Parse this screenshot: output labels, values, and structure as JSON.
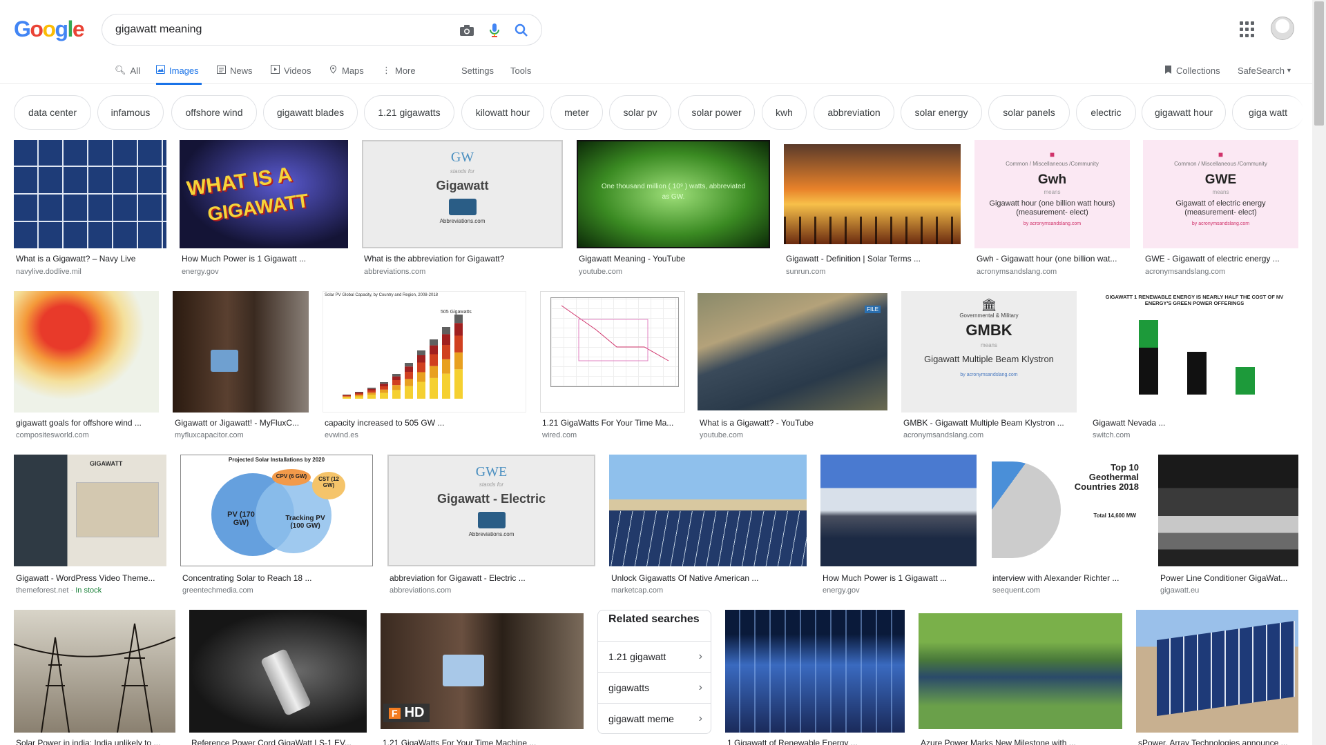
{
  "header": {
    "logo_text": "Google",
    "search_query": "gigawatt meaning"
  },
  "tabs": {
    "all": "All",
    "images": "Images",
    "news": "News",
    "videos": "Videos",
    "maps": "Maps",
    "more": "More",
    "settings": "Settings",
    "tools": "Tools",
    "collections": "Collections",
    "safesearch": "SafeSearch"
  },
  "chips": [
    "data center",
    "infamous",
    "offshore wind",
    "gigawatt blades",
    "1.21 gigawatts",
    "kilowatt hour",
    "meter",
    "solar pv",
    "solar power",
    "kwh",
    "abbreviation",
    "solar energy",
    "solar panels",
    "electric",
    "gigawatt hour",
    "giga watt"
  ],
  "results": [
    {
      "caption": "What is a Gigawatt? – Navy Live",
      "source": "navylive.dodlive.mil"
    },
    {
      "caption": "How Much Power is 1 Gigawatt ...",
      "source": "energy.gov"
    },
    {
      "caption": "What is the abbreviation for Gigawatt?",
      "source": "abbreviations.com"
    },
    {
      "caption": "Gigawatt Meaning - YouTube",
      "source": "youtube.com"
    },
    {
      "caption": "Gigawatt - Definition | Solar Terms ...",
      "source": "sunrun.com"
    },
    {
      "caption": "Gwh - Gigawatt hour (one billion wat...",
      "source": "acronymsandslang.com"
    },
    {
      "caption": "GWE - Gigawatt of electric energy ...",
      "source": "acronymsandslang.com"
    },
    {
      "caption": "gigawatt goals for offshore wind ...",
      "source": "compositesworld.com"
    },
    {
      "caption": "Gigawatt or Jigawatt! - MyFluxC...",
      "source": "myfluxcapacitor.com"
    },
    {
      "caption": "capacity increased to 505 GW ...",
      "source": "evwind.es"
    },
    {
      "caption": "1.21 GigaWatts For Your Time Ma...",
      "source": "wired.com"
    },
    {
      "caption": "What is a Gigawatt? - YouTube",
      "source": "youtube.com"
    },
    {
      "caption": "GMBK - Gigawatt Multiple Beam Klystron ...",
      "source": "acronymsandslang.com"
    },
    {
      "caption": "Gigawatt Nevada ...",
      "source": "switch.com"
    },
    {
      "caption": "Gigawatt - WordPress Video Theme...",
      "source": "themeforest.net",
      "source_extra": "In stock"
    },
    {
      "caption": "Concentrating Solar to Reach 18 ...",
      "source": "greentechmedia.com"
    },
    {
      "caption": "abbreviation for Gigawatt - Electric ...",
      "source": "abbreviations.com"
    },
    {
      "caption": "Unlock Gigawatts Of Native American ...",
      "source": "marketcap.com"
    },
    {
      "caption": "How Much Power is 1 Gigawatt ...",
      "source": "energy.gov"
    },
    {
      "caption": "interview with Alexander Richter ...",
      "source": "seequent.com"
    },
    {
      "caption": "Power Line Conditioner GigaWat...",
      "source": "gigawatt.eu"
    },
    {
      "caption": "Solar Power in india: India unlikely to ...",
      "source": ""
    },
    {
      "caption": "Reference Power Cord GigaWatt LS-1 EV...",
      "source": ""
    },
    {
      "caption": "1.21 GigaWatts For Your Time Machine ...",
      "source": ""
    },
    {
      "caption": "1 Gigawatt of Renewable Energy ...",
      "source": ""
    },
    {
      "caption": "Azure Power Marks New Milestone with ...",
      "source": ""
    },
    {
      "caption": "sPower, Array Technologies announce ...",
      "source": ""
    }
  ],
  "thumb_text": {
    "gw_abbr": "GW",
    "stands_for": "stands for",
    "gigawatt": "Gigawatt",
    "abbreviations_com": "Abbreviations.com",
    "youtube_text": "One thousand million ( 10⁹ ) watts, abbreviated as GW.",
    "gwh": "Gwh",
    "gwh_desc": "Gigawatt hour (one billion watt hours) (measurement- elect)",
    "gwe": "GWE",
    "gwe_desc": "Gigawatt of electric energy (measurement- elect)",
    "community": "Common / Miscellaneous /Community",
    "means": "means",
    "by_acronyms": "by acronymsandslang.com",
    "gmbk": "GMBK",
    "gmbk_cat": "Governmental & Military",
    "gmbk_desc": "Gigawatt Multiple Beam Klystron",
    "switch_title": "GIGAWATT 1 RENEWABLE ENERGY IS NEARLY HALF THE COST OF NV ENERGY'S GREEN POWER OFFERINGS",
    "what_is_a": "WHAT IS A",
    "gigawatt_caps": "GIGAWATT",
    "gwe_abbr": "GWE",
    "gigawatt_electric": "Gigawatt - Electric",
    "geo_title": "Top 10 Geothermal Countries 2018",
    "geo_total": "Total 14,600 MW",
    "venn_title": "Projected Solar Installations by 2020",
    "venn_pv": "PV (170 GW)",
    "venn_tracking": "Tracking PV (100 GW)",
    "venn_cpv": "CPV (6 GW)",
    "venn_cst": "CST (12 GW)",
    "hd_badge": "HD",
    "file_badge": "FILE",
    "wp_logo": "GIGAWATT",
    "ren21_title": "Solar PV Global Capacity, by Country and Region, 2008-2018",
    "ren21_total": "505 Gigawatts"
  },
  "related": {
    "title": "Related searches",
    "items": [
      "1.21 gigawatt",
      "gigawatts",
      "gigawatt meme"
    ]
  },
  "colors": {
    "accent": "#1a73e8",
    "text": "#202124",
    "muted": "#70757a",
    "in_stock": "#188038"
  }
}
